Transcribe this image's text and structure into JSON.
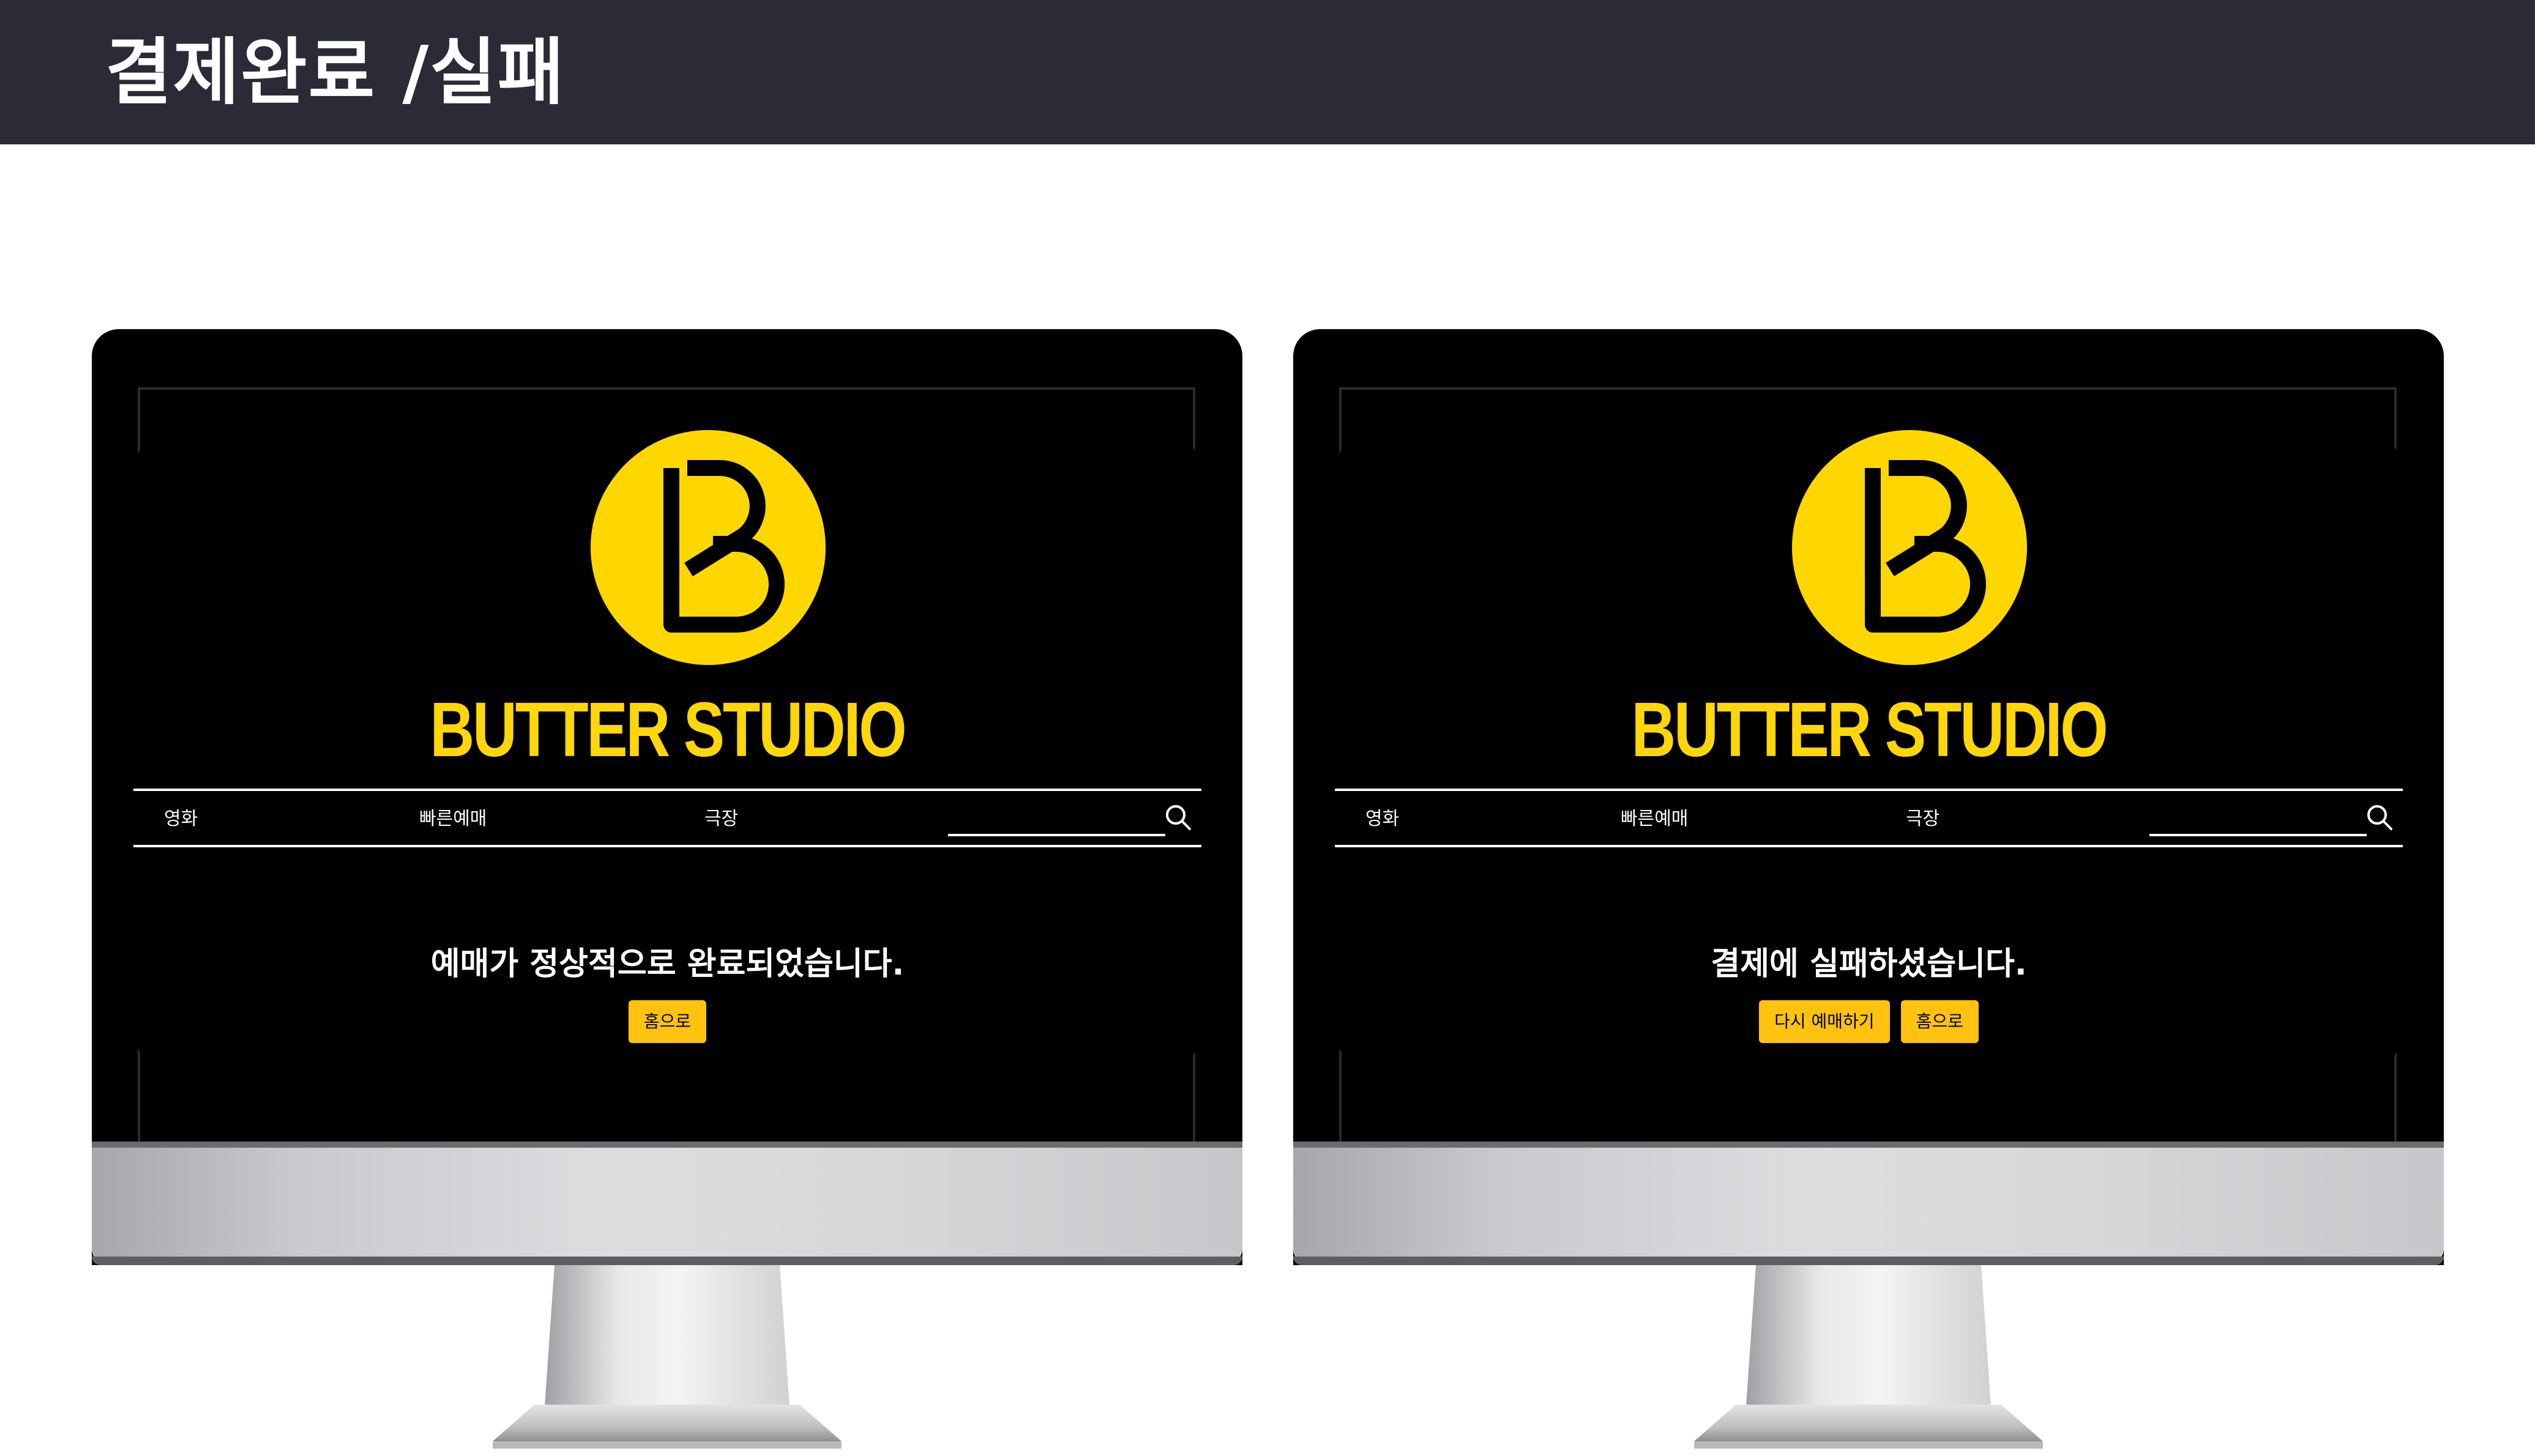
{
  "header": {
    "title": "결제완료 /실패"
  },
  "brand": {
    "name": "BUTTER STUDIO",
    "logo_letter": "B",
    "logo_color": "#ffd700",
    "accent_color": "#ffc20e"
  },
  "nav": {
    "items": [
      "영화",
      "빠른예매",
      "극장"
    ],
    "search_icon": "search-icon"
  },
  "screens": {
    "success": {
      "message": "예매가 정상적으로 완료되었습니다.",
      "buttons": [
        "홈으로"
      ]
    },
    "failure": {
      "message": "결제에 실패하셨습니다.",
      "buttons": [
        "다시 예매하기",
        "홈으로"
      ]
    }
  }
}
